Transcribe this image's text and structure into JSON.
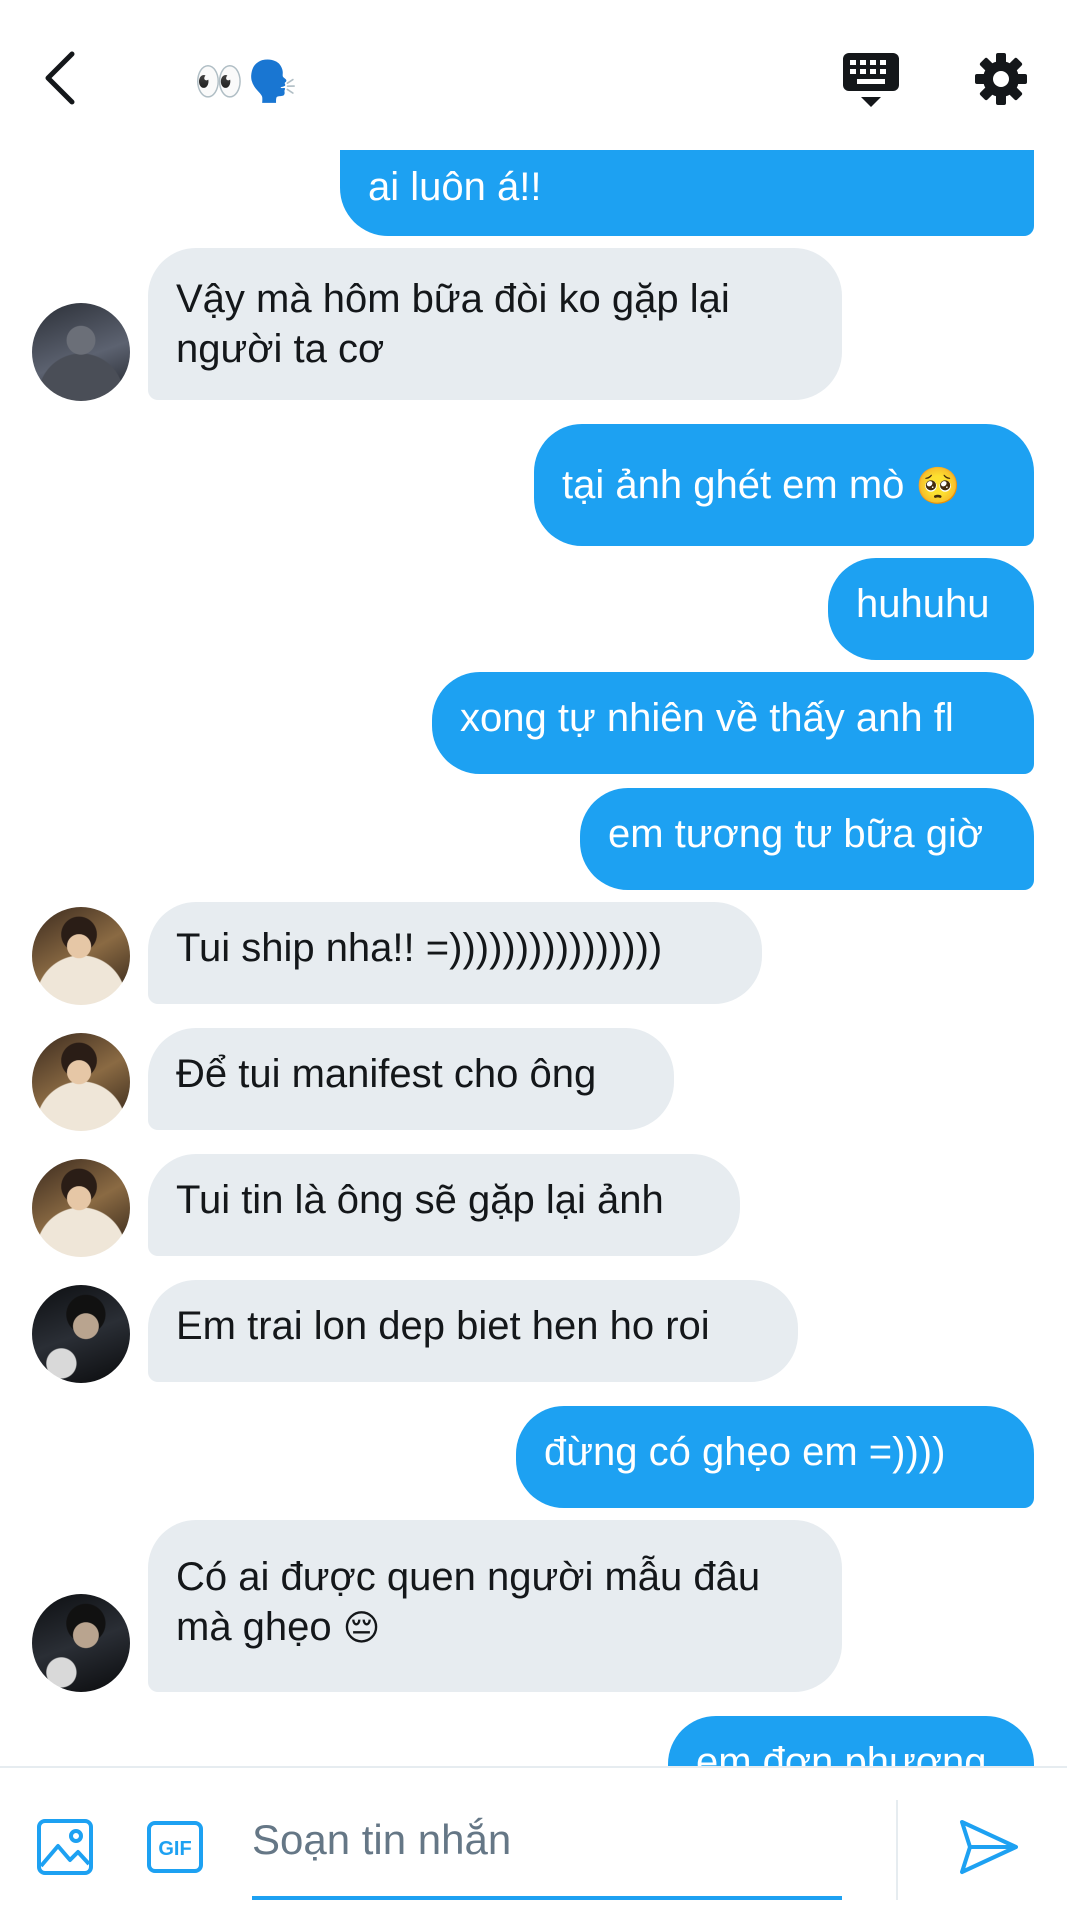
{
  "header": {
    "title": "👀🗣️"
  },
  "messages": [
    {
      "id": "m1",
      "side": "out",
      "text": "ai luôn á!!"
    },
    {
      "id": "m2",
      "side": "in",
      "line1": "Vậy mà hôm bữa đòi ko gặp lại",
      "line2": "người ta cơ"
    },
    {
      "id": "m3",
      "side": "out",
      "text": "tại ảnh ghét em mò",
      "emoji": "🥺"
    },
    {
      "id": "m4",
      "side": "out",
      "text": "huhuhu"
    },
    {
      "id": "m5",
      "side": "out",
      "text": "xong tự nhiên về thấy anh fl"
    },
    {
      "id": "m6",
      "side": "out",
      "text": "em tương tư bữa giờ"
    },
    {
      "id": "m7",
      "side": "in",
      "text": "Tui ship nha!! =))))))))))))))))"
    },
    {
      "id": "m8",
      "side": "in",
      "text": "Để tui manifest cho ông"
    },
    {
      "id": "m9",
      "side": "in",
      "text": "Tui tin là ông sẽ gặp lại ảnh"
    },
    {
      "id": "m10",
      "side": "in",
      "text": "Em trai lon dep biet hen ho roi"
    },
    {
      "id": "m11",
      "side": "out",
      "text": "đừng có ghẹo em =))))"
    },
    {
      "id": "m12",
      "side": "in",
      "line1": "Có ai được quen người mẫu đâu",
      "line2": "mà ghẹo",
      "emoji": "😔"
    },
    {
      "id": "m13",
      "side": "out",
      "text": "em đơn phương"
    }
  ],
  "composer": {
    "placeholder": "Soạn tin nhắn",
    "gif_label": "GIF"
  },
  "colors": {
    "accent": "#1da1f2",
    "incoming_bubble": "#e7ecf0",
    "text_primary": "#14171a",
    "placeholder": "#657786"
  },
  "icons": {
    "back": "chevron-left-icon",
    "keyboard": "keyboard-icon",
    "settings": "gear-icon",
    "image": "image-icon",
    "gif": "gif-icon",
    "send": "send-icon"
  }
}
